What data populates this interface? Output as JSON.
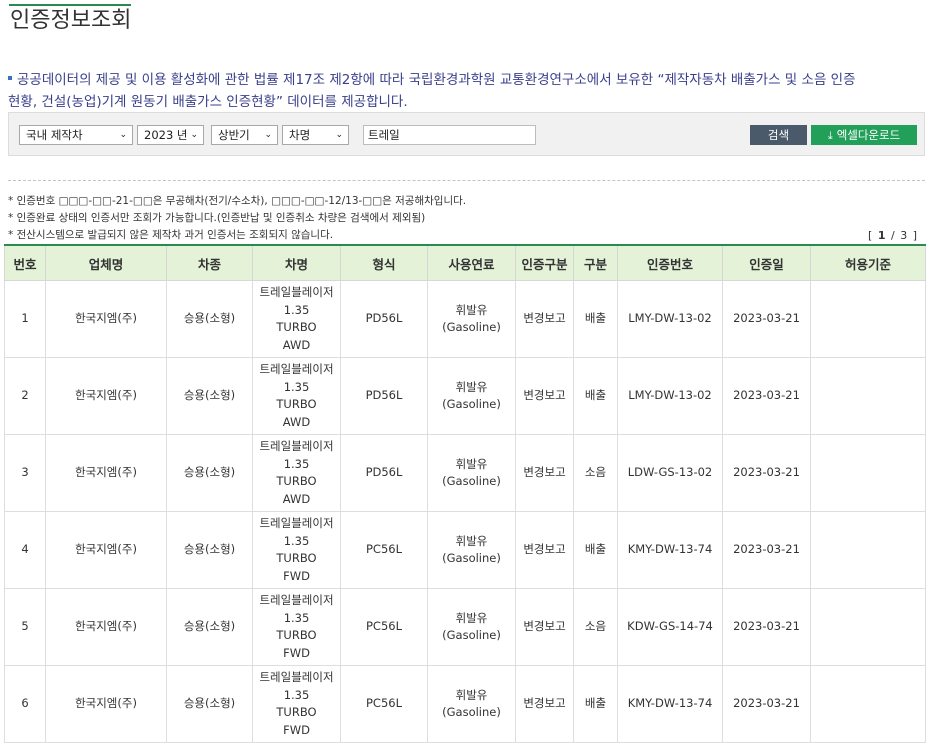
{
  "page": {
    "title": "인증정보조회",
    "intro_line1": "공공데이터의 제공 및 이용 활성화에 관한 법률 제17조 제2항에 따라 국립환경과학원 교통환경연구소에서 보유한 “제작자동차 배출가스 및 소음 인증",
    "intro_line2": "현황, 건설(농업)기계 원동기 배출가스 인증현황” 데이터를 제공합니다."
  },
  "search": {
    "vehicle_type": "국내 제작차",
    "year": "2023 년",
    "half": "상반기",
    "field": "차명",
    "query": "트레일",
    "search_label": "검색",
    "excel_label": "엑셀다운로드"
  },
  "notes": [
    "* 인증번호 □□□-□□-21-□□은 무공해차(전기/수소차), □□□-□□-12/13-□□은 저공해차입니다.",
    "* 인증완료 상태의 인증서만 조회가 가능합니다.(인증반납 및 인증취소 차량은 검색에서 제외됨)",
    "* 전산시스템으로 발급되지 않은 제작차 과거 인증서는 조회되지 않습니다."
  ],
  "pager": {
    "current": "1",
    "total": "3"
  },
  "table": {
    "headers": [
      "번호",
      "업체명",
      "차종",
      "차명",
      "형식",
      "사용연료",
      "인증구분",
      "구분",
      "인증번호",
      "인증일",
      "허용기준"
    ],
    "rows": [
      {
        "no": "1",
        "maker": "한국지엠(주)",
        "class": "승용(소형)",
        "name1": "트레일블레이저",
        "name2": "1.35",
        "name3": "TURBO",
        "name4": "AWD",
        "model": "PD56L",
        "fuel": "휘발유(Gasoline)",
        "certtype": "변경보고",
        "kind": "배출",
        "certno": "LMY-DW-13-02",
        "date": "2023-03-21",
        "std": ""
      },
      {
        "no": "2",
        "maker": "한국지엠(주)",
        "class": "승용(소형)",
        "name1": "트레일블레이저",
        "name2": "1.35",
        "name3": "TURBO",
        "name4": "AWD",
        "model": "PD56L",
        "fuel": "휘발유(Gasoline)",
        "certtype": "변경보고",
        "kind": "배출",
        "certno": "LMY-DW-13-02",
        "date": "2023-03-21",
        "std": ""
      },
      {
        "no": "3",
        "maker": "한국지엠(주)",
        "class": "승용(소형)",
        "name1": "트레일블레이저",
        "name2": "1.35",
        "name3": "TURBO",
        "name4": "AWD",
        "model": "PD56L",
        "fuel": "휘발유(Gasoline)",
        "certtype": "변경보고",
        "kind": "소음",
        "certno": "LDW-GS-13-02",
        "date": "2023-03-21",
        "std": ""
      },
      {
        "no": "4",
        "maker": "한국지엠(주)",
        "class": "승용(소형)",
        "name1": "트레일블레이저",
        "name2": "1.35",
        "name3": "TURBO",
        "name4": "FWD",
        "model": "PC56L",
        "fuel": "휘발유(Gasoline)",
        "certtype": "변경보고",
        "kind": "배출",
        "certno": "KMY-DW-13-74",
        "date": "2023-03-21",
        "std": ""
      },
      {
        "no": "5",
        "maker": "한국지엠(주)",
        "class": "승용(소형)",
        "name1": "트레일블레이저",
        "name2": "1.35",
        "name3": "TURBO",
        "name4": "FWD",
        "model": "PC56L",
        "fuel": "휘발유(Gasoline)",
        "certtype": "변경보고",
        "kind": "소음",
        "certno": "KDW-GS-14-74",
        "date": "2023-03-21",
        "std": ""
      },
      {
        "no": "6",
        "maker": "한국지엠(주)",
        "class": "승용(소형)",
        "name1": "트레일블레이저",
        "name2": "1.35",
        "name3": "TURBO",
        "name4": "FWD",
        "model": "PC56L",
        "fuel": "휘발유(Gasoline)",
        "certtype": "변경보고",
        "kind": "배출",
        "certno": "KMY-DW-13-74",
        "date": "2023-03-21",
        "std": ""
      }
    ]
  }
}
